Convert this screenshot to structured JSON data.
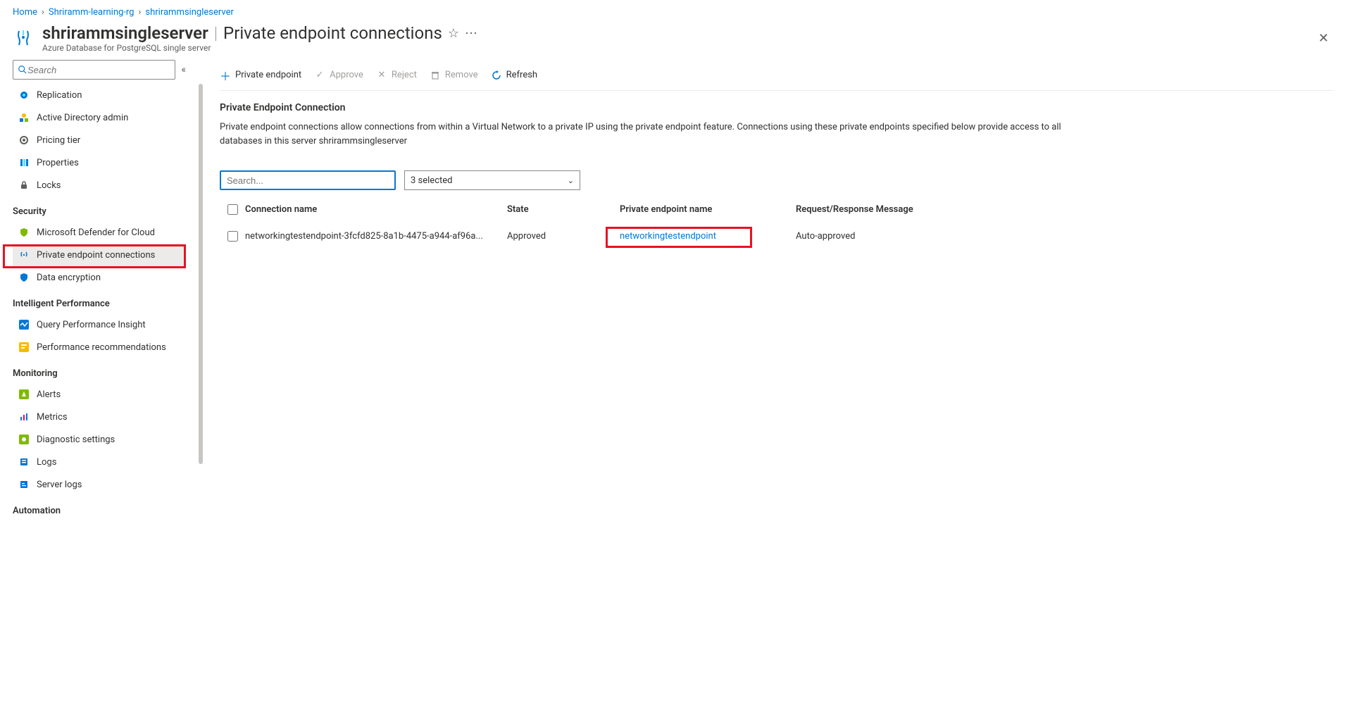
{
  "breadcrumb": {
    "items": [
      "Home",
      "Shriramm-learning-rg",
      "shrirammsingleserver"
    ]
  },
  "header": {
    "resource_name": "shrirammsingleserver",
    "blade_name": "Private endpoint connections",
    "resource_type": "Azure Database for PostgreSQL single server"
  },
  "sidebar": {
    "search_placeholder": "Search",
    "items_top": [
      {
        "icon": "replication",
        "label": "Replication"
      },
      {
        "icon": "aad",
        "label": "Active Directory admin"
      },
      {
        "icon": "pricing",
        "label": "Pricing tier"
      },
      {
        "icon": "properties",
        "label": "Properties"
      },
      {
        "icon": "locks",
        "label": "Locks"
      }
    ],
    "group_security": "Security",
    "items_security": [
      {
        "icon": "defender",
        "label": "Microsoft Defender for Cloud"
      },
      {
        "icon": "pep",
        "label": "Private endpoint connections",
        "selected": true
      },
      {
        "icon": "encryption",
        "label": "Data encryption"
      }
    ],
    "group_intel": "Intelligent Performance",
    "items_intel": [
      {
        "icon": "qpi",
        "label": "Query Performance Insight"
      },
      {
        "icon": "perfrec",
        "label": "Performance recommendations"
      }
    ],
    "group_monitoring": "Monitoring",
    "items_monitoring": [
      {
        "icon": "alerts",
        "label": "Alerts"
      },
      {
        "icon": "metrics",
        "label": "Metrics"
      },
      {
        "icon": "diag",
        "label": "Diagnostic settings"
      },
      {
        "icon": "logs",
        "label": "Logs"
      },
      {
        "icon": "serverlogs",
        "label": "Server logs"
      }
    ],
    "group_automation": "Automation"
  },
  "commands": {
    "add": "Private endpoint",
    "approve": "Approve",
    "reject": "Reject",
    "remove": "Remove",
    "refresh": "Refresh"
  },
  "section": {
    "title": "Private Endpoint Connection",
    "description": "Private endpoint connections allow connections from within a Virtual Network to a private IP using the private endpoint feature. Connections using these private endpoints specified below provide access to all databases in this server shrirammsingleserver"
  },
  "filters": {
    "search_placeholder": "Search...",
    "state_label": "3 selected"
  },
  "table": {
    "headers": {
      "connection": "Connection name",
      "state": "State",
      "pep": "Private endpoint name",
      "msg": "Request/Response Message"
    },
    "rows": [
      {
        "connection": "networkingtestendpoint-3fcfd825-8a1b-4475-a944-af96a...",
        "state": "Approved",
        "pep": "networkingtestendpoint",
        "msg": "Auto-approved"
      }
    ]
  }
}
